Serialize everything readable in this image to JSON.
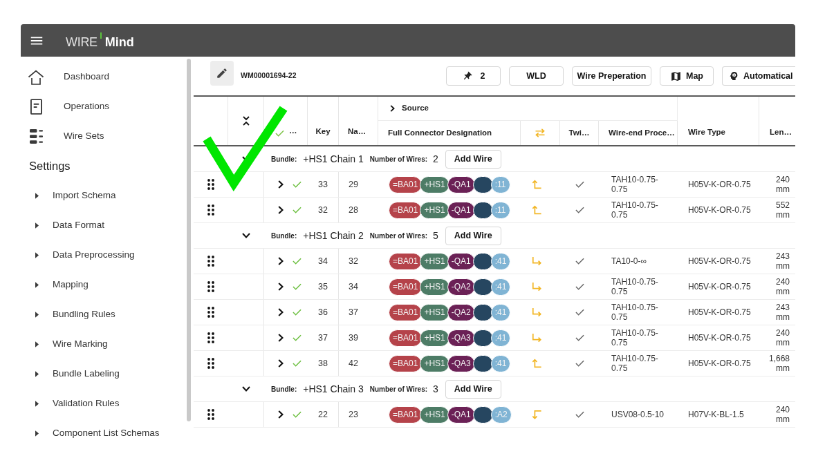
{
  "app_bar": {
    "logo_prefix": "WIRE",
    "logo_name": "Mind"
  },
  "sidebar": {
    "items": [
      {
        "label": "Dashboard"
      },
      {
        "label": "Operations"
      },
      {
        "label": "Wire Sets"
      }
    ],
    "settings": {
      "title": "Settings",
      "items": [
        {
          "label": "Import Schema",
          "expanded": false
        },
        {
          "label": "Data Format",
          "expanded": false
        },
        {
          "label": "Data Preprocessing",
          "expanded": false
        },
        {
          "label": "Mapping",
          "expanded": false
        },
        {
          "label": "Bundling Rules",
          "expanded": false
        },
        {
          "label": "Wire Marking",
          "expanded": false
        },
        {
          "label": "Bundle Labeling",
          "expanded": false
        },
        {
          "label": "Validation Rules",
          "expanded": false
        },
        {
          "label": "Component List Schemas",
          "expanded": false
        }
      ]
    }
  },
  "toolbar": {
    "document_id": "WM00001694-22",
    "buttons": [
      {
        "kind": "pin",
        "label": "2"
      },
      {
        "kind": "plain",
        "label": "WLD"
      },
      {
        "kind": "plain",
        "label": "Wire Preperation"
      },
      {
        "kind": "map",
        "label": "Map"
      },
      {
        "kind": "idea",
        "label": "Automatical"
      }
    ]
  },
  "table": {
    "group": {
      "label": "Source",
      "expanded": false
    },
    "columns": [
      {
        "label": "…"
      },
      {
        "label": "Key"
      },
      {
        "label": "Na…"
      },
      {
        "label": "Full Connector Designation"
      },
      {
        "label": "Twi…"
      },
      {
        "label": "Wire-end Proce…"
      },
      {
        "label": "Wire Type"
      },
      {
        "label": "Len…"
      }
    ],
    "bundles": [
      {
        "expanded": true,
        "label": "Bundle:",
        "name": "+HS1 Chain 1",
        "count_label": "Number of Wires:",
        "count": "2",
        "button": "Add Wire",
        "rows": [
          {
            "kind": "up",
            "expanded": false,
            "checked": true,
            "key": "33",
            "na": "29",
            "connector": [
              {
                "text": "=BA01",
                "color": "#b5434a"
              },
              {
                "text": "+HS1",
                "color": "#4d7c66"
              },
              {
                "text": "-QA1",
                "color": "#6b2156"
              },
              {
                "color": "#264660"
              },
              {
                "text": ":11",
                "color": "#80b4d4"
              }
            ],
            "twi_checked": true,
            "wire_end": "TAH10-0.75-0.75",
            "wire_type": "H05V-K-OR-0.75",
            "length": "240 mm"
          },
          {
            "kind": "up",
            "expanded": false,
            "checked": true,
            "key": "32",
            "na": "28",
            "connector": [
              {
                "text": "=BA01",
                "color": "#b5434a"
              },
              {
                "text": "+HS1",
                "color": "#4d7c66"
              },
              {
                "text": "-QA1",
                "color": "#6b2156"
              },
              {
                "color": "#264660"
              },
              {
                "text": ":11",
                "color": "#80b4d4"
              }
            ],
            "twi_checked": true,
            "wire_end": "TAH10-0.75-0.75",
            "wire_type": "H05V-K-OR-0.75",
            "length": "552 mm"
          }
        ]
      },
      {
        "expanded": true,
        "label": "Bundle:",
        "name": "+HS1 Chain 2",
        "count_label": "Number of Wires:",
        "count": "5",
        "button": "Add Wire",
        "rows": [
          {
            "kind": "right",
            "expanded": false,
            "checked": true,
            "key": "34",
            "na": "32",
            "connector": [
              {
                "text": "=BA01",
                "color": "#b5434a"
              },
              {
                "text": "+HS1",
                "color": "#4d7c66"
              },
              {
                "text": "-QA1",
                "color": "#6b2156"
              },
              {
                "color": "#264660"
              },
              {
                "text": ":41",
                "color": "#80b4d4"
              }
            ],
            "twi_checked": true,
            "wire_end": "TA10-0-∞",
            "wire_type": "H05V-K-OR-0.75",
            "length": "243 mm"
          },
          {
            "kind": "right",
            "expanded": false,
            "checked": true,
            "key": "35",
            "na": "34",
            "connector": [
              {
                "text": "=BA01",
                "color": "#b5434a"
              },
              {
                "text": "+HS1",
                "color": "#4d7c66"
              },
              {
                "text": "-QA2",
                "color": "#6b2156"
              },
              {
                "color": "#264660"
              },
              {
                "text": ":41",
                "color": "#80b4d4"
              }
            ],
            "twi_checked": true,
            "wire_end": "TAH10-0.75-0.75",
            "wire_type": "H05V-K-OR-0.75",
            "length": "240 mm"
          },
          {
            "kind": "right",
            "expanded": false,
            "checked": true,
            "key": "36",
            "na": "37",
            "connector": [
              {
                "text": "=BA01",
                "color": "#b5434a"
              },
              {
                "text": "+HS1",
                "color": "#4d7c66"
              },
              {
                "text": "-QA2",
                "color": "#6b2156"
              },
              {
                "color": "#264660"
              },
              {
                "text": ":41",
                "color": "#80b4d4"
              }
            ],
            "twi_checked": true,
            "wire_end": "TAH10-0.75-0.75",
            "wire_type": "H05V-K-OR-0.75",
            "length": "243 mm"
          },
          {
            "kind": "right",
            "expanded": false,
            "checked": true,
            "key": "37",
            "na": "39",
            "connector": [
              {
                "text": "=BA01",
                "color": "#b5434a"
              },
              {
                "text": "+HS1",
                "color": "#4d7c66"
              },
              {
                "text": "-QA3",
                "color": "#6b2156"
              },
              {
                "color": "#264660"
              },
              {
                "text": ":41",
                "color": "#80b4d4"
              }
            ],
            "twi_checked": true,
            "wire_end": "TAH10-0.75-0.75",
            "wire_type": "H05V-K-OR-0.75",
            "length": "240 mm"
          },
          {
            "kind": "up",
            "expanded": false,
            "checked": true,
            "key": "38",
            "na": "42",
            "connector": [
              {
                "text": "=BA01",
                "color": "#b5434a"
              },
              {
                "text": "+HS1",
                "color": "#4d7c66"
              },
              {
                "text": "-QA3",
                "color": "#6b2156"
              },
              {
                "color": "#264660"
              },
              {
                "text": ":41",
                "color": "#80b4d4"
              }
            ],
            "twi_checked": true,
            "wire_end": "TAH10-0.75-0.75",
            "wire_type": "H05V-K-OR-0.75",
            "length": "1,668 mm"
          }
        ]
      },
      {
        "expanded": true,
        "label": "Bundle:",
        "name": "+HS1 Chain 3",
        "count_label": "Number of Wires:",
        "count": "3",
        "button": "Add Wire",
        "rows": [
          {
            "kind": "down",
            "expanded": false,
            "checked": true,
            "key": "22",
            "na": "23",
            "connector": [
              {
                "text": "=BA01",
                "color": "#b5434a"
              },
              {
                "text": "+HS1",
                "color": "#4d7c66"
              },
              {
                "text": "-QA1",
                "color": "#6b2156"
              },
              {
                "color": "#264660"
              },
              {
                "text": ":A2",
                "color": "#80b4d4"
              }
            ],
            "twi_checked": true,
            "wire_end": "USV08-0.5-10",
            "wire_type": "H07V-K-BL-1.5",
            "length": "240 mm"
          }
        ]
      }
    ]
  }
}
